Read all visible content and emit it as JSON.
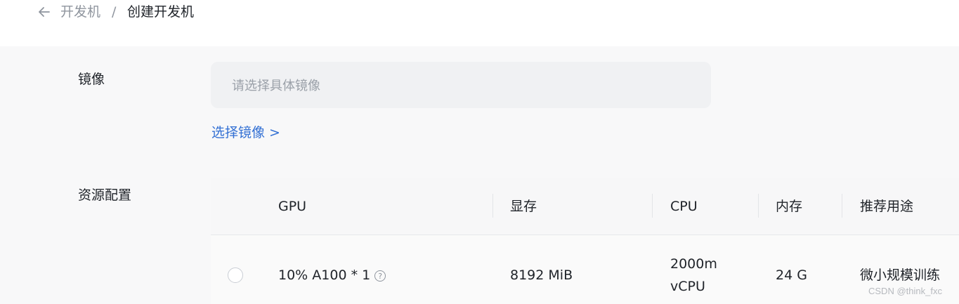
{
  "breadcrumb": {
    "parent": "开发机",
    "separator": "/",
    "current": "创建开发机"
  },
  "image": {
    "label": "镜像",
    "placeholder": "请选择具体镜像",
    "choose_link": "选择镜像 >"
  },
  "resource": {
    "label": "资源配置",
    "columns": [
      "GPU",
      "显存",
      "CPU",
      "内存",
      "推荐用途"
    ],
    "rows": [
      {
        "gpu": "10% A100 * 1",
        "vram": "8192 MiB",
        "cpu_line1": "2000m",
        "cpu_line2": "vCPU",
        "memory": "24 G",
        "usage": "微小规模训练"
      }
    ]
  },
  "watermark": "CSDN @think_fxc",
  "colors": {
    "link": "#3370d4",
    "page_bg": "#f8f8f9",
    "input_bg": "#f0f1f3"
  }
}
